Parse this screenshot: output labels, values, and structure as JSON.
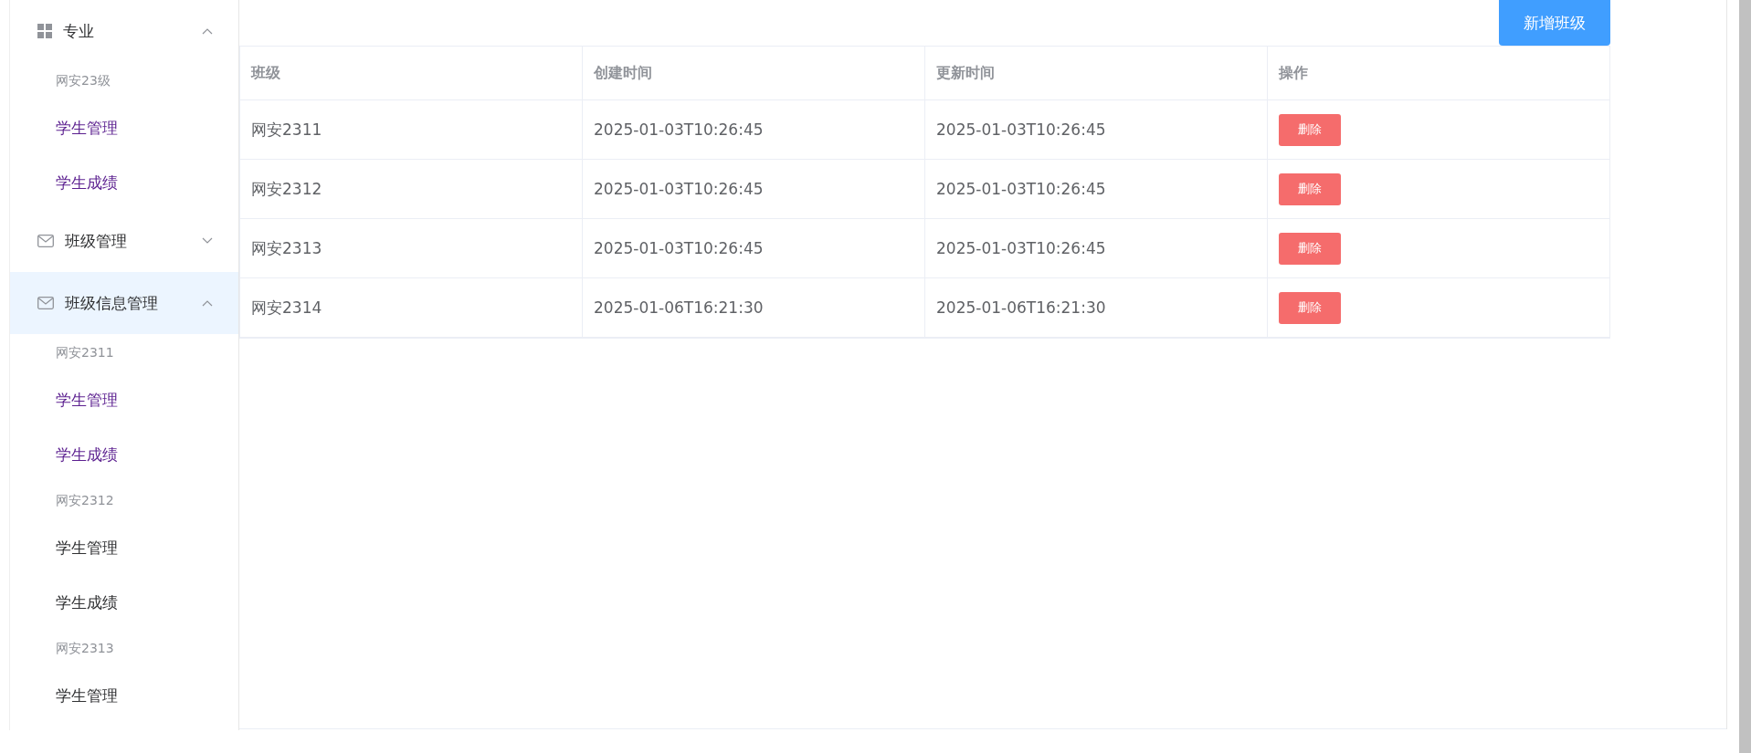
{
  "sidebar": {
    "menus": [
      {
        "kind": "grid",
        "title": "专业",
        "expanded": true,
        "highlighted": false,
        "groups": [
          {
            "title": "网安23级",
            "items": [
              {
                "label": "学生管理",
                "visited": true
              },
              {
                "label": "学生成绩",
                "visited": true
              }
            ]
          }
        ]
      },
      {
        "kind": "mail",
        "title": "班级管理",
        "expanded": false,
        "highlighted": false
      },
      {
        "kind": "mail",
        "title": "班级信息管理",
        "expanded": true,
        "highlighted": true,
        "groups": [
          {
            "title": "网安2311",
            "items": [
              {
                "label": "学生管理",
                "visited": true
              },
              {
                "label": "学生成绩",
                "visited": true
              }
            ]
          },
          {
            "title": "网安2312",
            "items": [
              {
                "label": "学生管理",
                "visited": false
              },
              {
                "label": "学生成绩",
                "visited": false
              }
            ]
          },
          {
            "title": "网安2313",
            "items": [
              {
                "label": "学生管理",
                "visited": false
              }
            ]
          }
        ]
      }
    ]
  },
  "add_button": "新增班级",
  "table": {
    "columns": [
      "班级",
      "创建时间",
      "更新时间",
      "操作"
    ],
    "rows": [
      {
        "class": "网安2311",
        "created": "2025-01-03T10:26:45",
        "updated": "2025-01-03T10:26:45",
        "action": "删除"
      },
      {
        "class": "网安2312",
        "created": "2025-01-03T10:26:45",
        "updated": "2025-01-03T10:26:45",
        "action": "删除"
      },
      {
        "class": "网安2313",
        "created": "2025-01-03T10:26:45",
        "updated": "2025-01-03T10:26:45",
        "action": "删除"
      },
      {
        "class": "网安2314",
        "created": "2025-01-06T16:21:30",
        "updated": "2025-01-06T16:21:30",
        "action": "删除"
      }
    ]
  }
}
